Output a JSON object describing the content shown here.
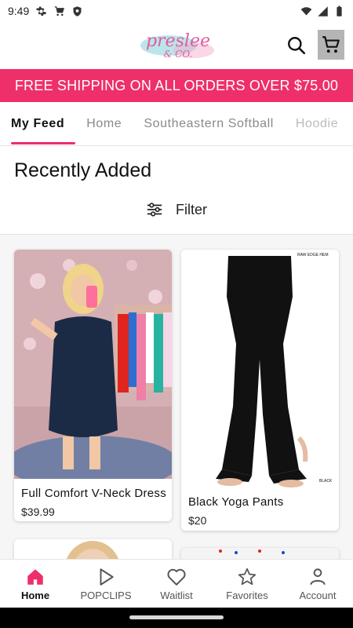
{
  "status_bar": {
    "time": "9:49"
  },
  "header": {
    "logo_text": "preslee",
    "logo_sub": "& CO."
  },
  "banner": {
    "text": "FREE SHIPPING ON ALL ORDERS OVER $75.00"
  },
  "tabs": [
    {
      "label": "My Feed",
      "active": true
    },
    {
      "label": "Home"
    },
    {
      "label": "Southeastern Softball"
    },
    {
      "label": "Hoodie"
    }
  ],
  "section": {
    "title": "Recently Added",
    "filter_label": "Filter"
  },
  "products": [
    {
      "name": "Full Comfort V-Neck Dress",
      "price": "$39.99"
    },
    {
      "name": "Black Yoga Pants",
      "price": "$20",
      "image_tag_top": "RAW EDGE HEM",
      "image_tag_bottom": "BLACK"
    }
  ],
  "bottom_nav": [
    {
      "label": "Home",
      "icon": "home-icon",
      "active": true
    },
    {
      "label": "POPCLIPS",
      "icon": "play-icon"
    },
    {
      "label": "Waitlist",
      "icon": "heart-icon"
    },
    {
      "label": "Favorites",
      "icon": "star-icon"
    },
    {
      "label": "Account",
      "icon": "person-icon"
    }
  ],
  "colors": {
    "accent": "#ee2f6a",
    "cart_bg": "#b5b5b5",
    "logo": "#e25ca0"
  }
}
